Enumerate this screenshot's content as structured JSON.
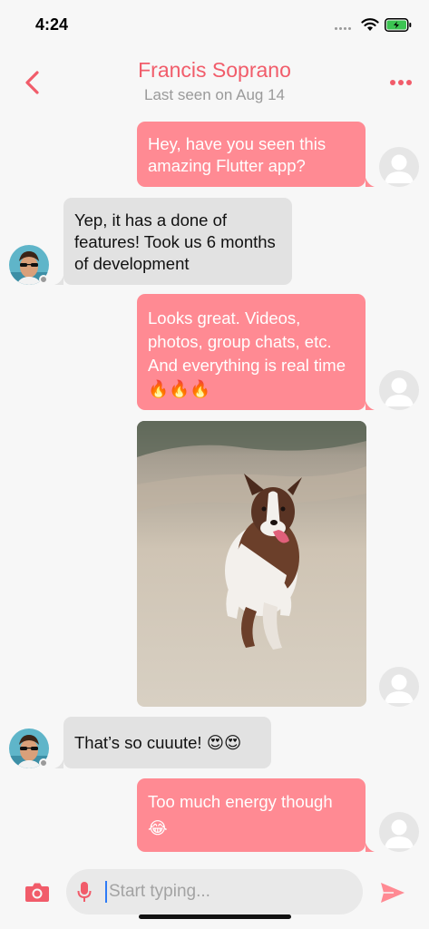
{
  "status_bar": {
    "time": "4:24"
  },
  "header": {
    "title": "Francis Soprano",
    "subtitle": "Last seen on Aug 14"
  },
  "messages": [
    {
      "direction": "outgoing",
      "text": "Hey, have you seen this amazing Flutter app?"
    },
    {
      "direction": "incoming",
      "text": "Yep, it has a done of features! Took us 6 months of development"
    },
    {
      "direction": "outgoing",
      "text": "Looks great. Videos, photos, group chats, etc. And everything is real time 🔥🔥🔥"
    },
    {
      "direction": "outgoing",
      "type": "photo"
    },
    {
      "direction": "incoming",
      "text": "That’s so cuuute! 😍😍"
    },
    {
      "direction": "outgoing",
      "text": "Too much energy though 😂"
    }
  ],
  "composer": {
    "placeholder": "Start typing..."
  },
  "colors": {
    "accent": "#f15c6a",
    "outgoing_bubble": "#ff8a93",
    "incoming_bubble": "#e2e2e2"
  }
}
